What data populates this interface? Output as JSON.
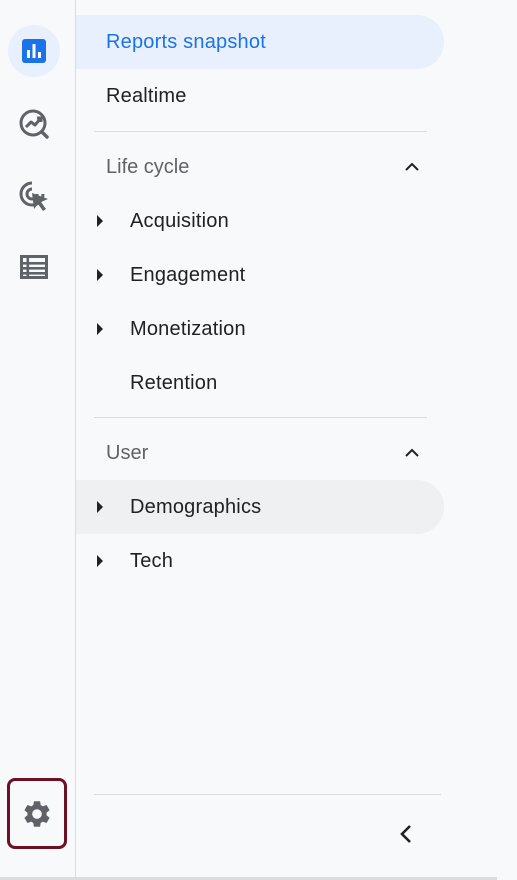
{
  "rail": {
    "items": [
      {
        "icon": "bar-chart-icon",
        "active": true
      },
      {
        "icon": "explore-trend-icon",
        "active": false
      },
      {
        "icon": "cursor-target-icon",
        "active": false
      },
      {
        "icon": "list-table-icon",
        "active": false
      }
    ],
    "admin_icon": "gear-icon"
  },
  "nav": {
    "reports_snapshot": "Reports snapshot",
    "realtime": "Realtime",
    "lifecycle": {
      "label": "Life cycle",
      "items": [
        "Acquisition",
        "Engagement",
        "Monetization",
        "Retention"
      ]
    },
    "user": {
      "label": "User",
      "items": [
        "Demographics",
        "Tech"
      ]
    }
  },
  "colors": {
    "accent": "#1a73e8",
    "selected_bg": "#e8f0fe",
    "admin_outline": "#6d1024"
  }
}
